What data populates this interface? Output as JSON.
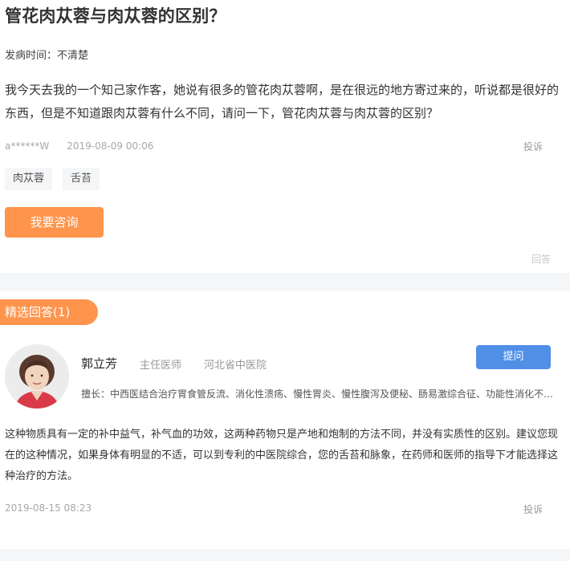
{
  "question": {
    "title": "管花肉苁蓉与肉苁蓉的区别？",
    "onset": "发病时间：不清楚",
    "body": "我今天去我的一个知己家作客，她说有很多的管花肉苁蓉啊，是在很远的地方寄过来的，听说都是很好的东西，但是不知道跟肉苁蓉有什么不同，请问一下，管花肉苁蓉与肉苁蓉的区别？",
    "user": "a******W",
    "date": "2019-08-09 00:06",
    "report_label": "投诉",
    "tags": [
      "肉苁蓉",
      "舌苔"
    ],
    "consult_button": "我要咨询",
    "reply_label": "回答"
  },
  "answers": {
    "section_label": "精选回答(1)",
    "doctor": {
      "name": "郭立芳",
      "title": "主任医师",
      "hospital": "河北省中医院",
      "specialty": "擅长：中西医结合治疗胃食管反流、消化性溃疡、慢性胃炎、慢性腹泻及便秘、肠易激综合征、功能性消化不良等消化系统疾病",
      "ask_button": "提问"
    },
    "body": "这种物质具有一定的补中益气，补气血的功效，这两种药物只是产地和炮制的方法不同，并没有实质性的区别。建议您现在的这种情况，如果身体有明显的不适，可以到专利的中医院综合，您的舌苔和脉象，在药师和医师的指导下才能选择这种治疗的方法。",
    "date": "2019-08-15 08:23",
    "report_label": "投诉"
  },
  "colors": {
    "accent_orange": "#ff944d",
    "accent_blue": "#4f8fe6",
    "band_gray": "#f5f6f8"
  }
}
